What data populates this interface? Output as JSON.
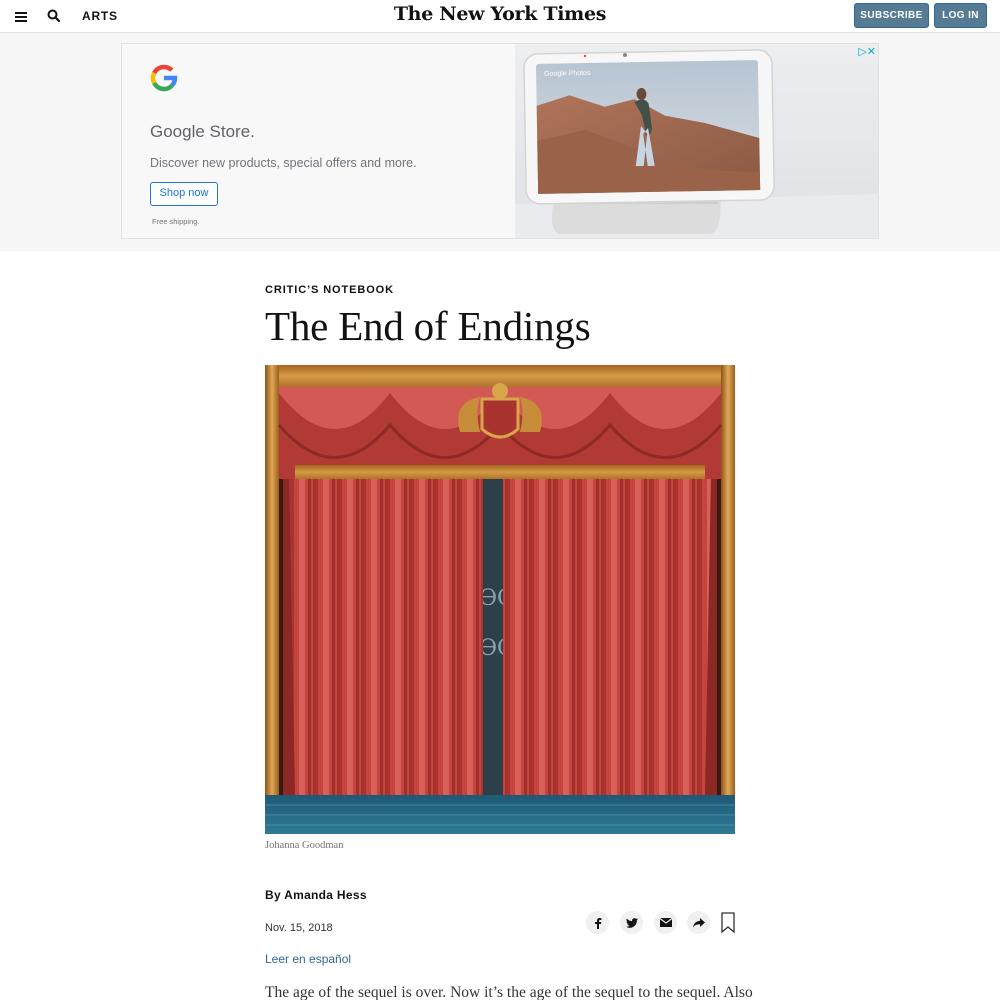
{
  "header": {
    "section": "ARTS",
    "logo": "The New York Times",
    "subscribe_label": "SUBSCRIBE",
    "login_label": "LOG IN"
  },
  "ad": {
    "title": "Google Store.",
    "description": "Discover new products, special offers and more.",
    "button_label": "Shop now",
    "fine_print": "Free shipping.",
    "screen_label": "Google Photos",
    "adchoices": "▷✕"
  },
  "article": {
    "kicker": "CRITIC’S NOTEBOOK",
    "headline": "The End of Endings",
    "image_credit": "Johanna Goodman",
    "byline": "By Amanda Hess",
    "date": "Nov. 15, 2018",
    "translation_link": "Leer en español",
    "first_line": "The age of the sequel is over. Now it’s the age of the sequel to the sequel. Also"
  },
  "share": {
    "icons": [
      "facebook-icon",
      "twitter-icon",
      "email-icon",
      "share-icon",
      "bookmark-icon"
    ]
  },
  "colors": {
    "button": "#567b95",
    "link": "#326891",
    "curtain": "#c6443e",
    "google_blue": "#1a73e8"
  }
}
